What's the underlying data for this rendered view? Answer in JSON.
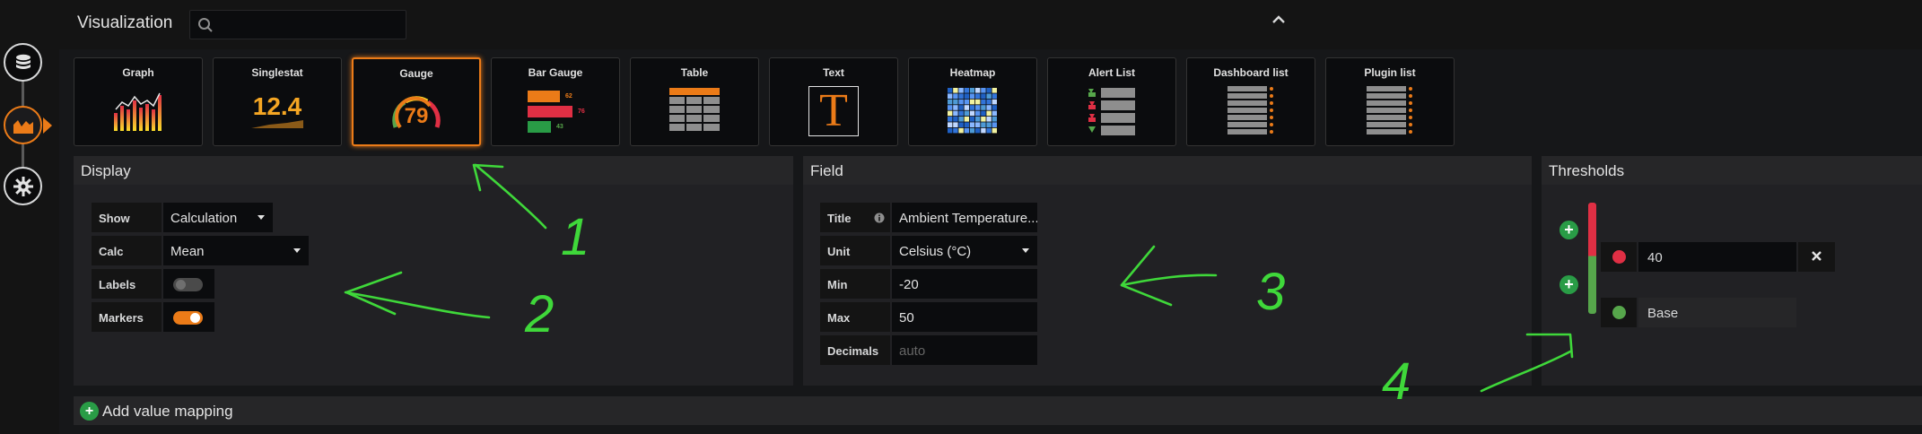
{
  "sidebar": {
    "items": [
      {
        "name": "queries",
        "icon": "database-icon",
        "active": false
      },
      {
        "name": "visualization",
        "icon": "chart-icon",
        "active": true
      },
      {
        "name": "general",
        "icon": "gear-icon",
        "active": false
      }
    ]
  },
  "visualization": {
    "title": "Visualization",
    "search_placeholder": "",
    "tiles": [
      {
        "label": "Graph"
      },
      {
        "label": "Singlestat",
        "sample": "12.4"
      },
      {
        "label": "Gauge",
        "sample": "79",
        "selected": true
      },
      {
        "label": "Bar Gauge",
        "samples": [
          "62",
          "76",
          "43"
        ]
      },
      {
        "label": "Table"
      },
      {
        "label": "Text",
        "sample": "T"
      },
      {
        "label": "Heatmap"
      },
      {
        "label": "Alert List"
      },
      {
        "label": "Dashboard list"
      },
      {
        "label": "Plugin list"
      }
    ]
  },
  "display": {
    "title": "Display",
    "show_label": "Show",
    "show_value": "Calculation",
    "calc_label": "Calc",
    "calc_value": "Mean",
    "labels_label": "Labels",
    "labels_on": false,
    "markers_label": "Markers",
    "markers_on": true
  },
  "field": {
    "title": "Field",
    "title_label": "Title",
    "title_value": "Ambient Temperature...",
    "unit_label": "Unit",
    "unit_value": "Celsius (°C)",
    "min_label": "Min",
    "min_value": "-20",
    "max_label": "Max",
    "max_value": "50",
    "decimals_label": "Decimals",
    "decimals_placeholder": "auto"
  },
  "thresholds": {
    "title": "Thresholds",
    "items": [
      {
        "value": "40",
        "color": "#e02f44"
      },
      {
        "value": "Base",
        "color": "#56a64b"
      }
    ]
  },
  "value_mapping": {
    "add_label": "Add value mapping"
  },
  "annotations": {
    "marks": [
      "1",
      "2",
      "3",
      "4"
    ],
    "color": "#3fd83a"
  },
  "colors": {
    "accent": "#eb7b18",
    "ok": "#299c46",
    "critical": "#e02f44"
  }
}
